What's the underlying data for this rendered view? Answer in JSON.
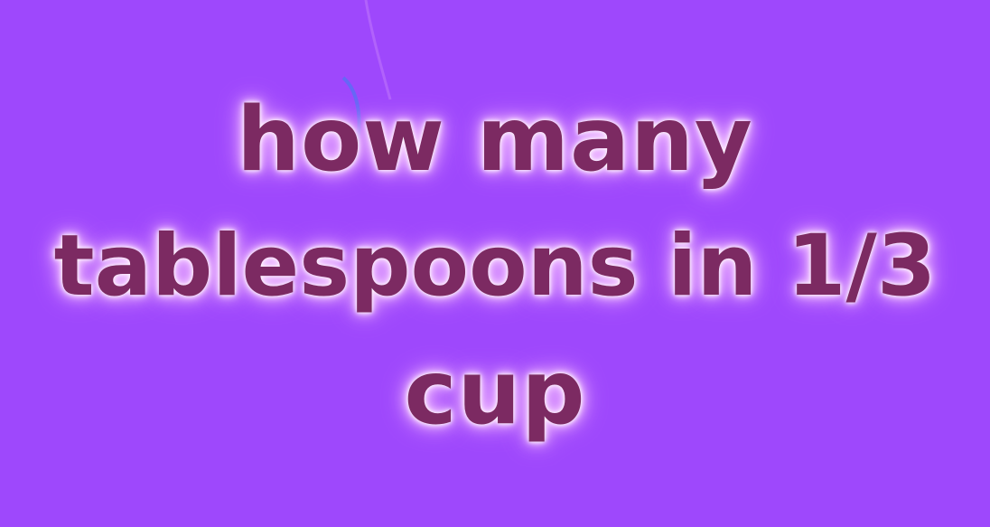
{
  "headline": {
    "lines": [
      "how many",
      "tablespoons in 1/3",
      "cup"
    ]
  },
  "colors": {
    "background": "#9e48fc",
    "text": "#7c2a62",
    "glow": "#f6c9ff"
  }
}
